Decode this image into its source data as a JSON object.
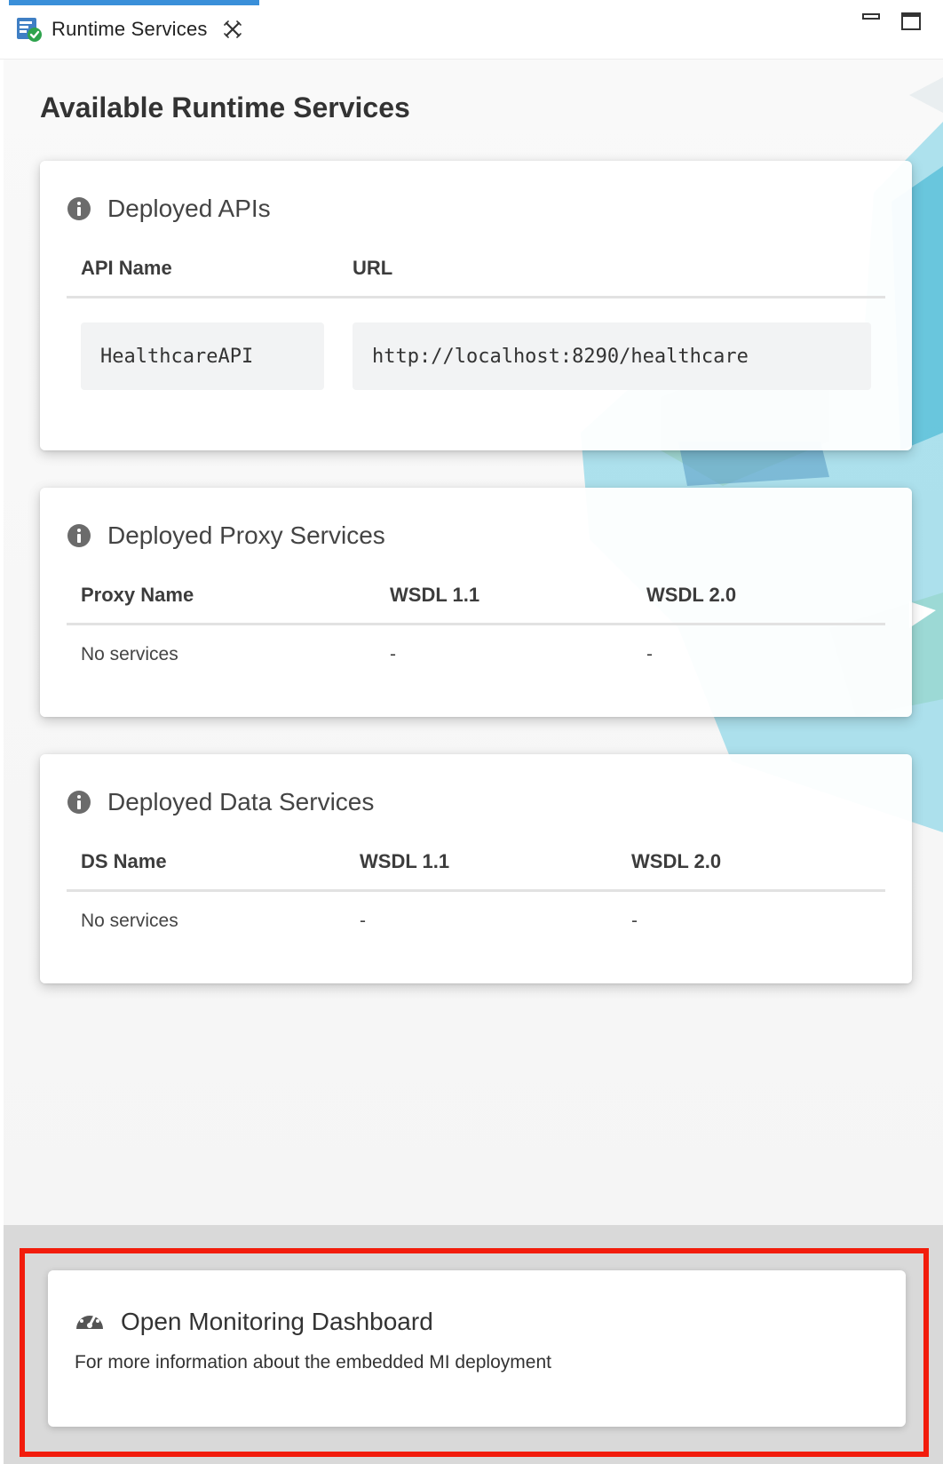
{
  "tab": {
    "title": "Runtime Services",
    "icon": "runtime-services-icon",
    "close_icon": "close-icon"
  },
  "window_controls": {
    "minimize_icon": "minimize-icon",
    "maximize_icon": "maximize-icon"
  },
  "page": {
    "title": "Available Runtime Services"
  },
  "apis": {
    "title": "Deployed APIs",
    "icon": "info-icon",
    "columns": [
      "API Name",
      "URL"
    ],
    "rows": [
      {
        "name": "HealthcareAPI",
        "url": "http://localhost:8290/healthcare"
      }
    ]
  },
  "proxy_services": {
    "title": "Deployed Proxy Services",
    "icon": "info-icon",
    "columns": [
      "Proxy Name",
      "WSDL 1.1",
      "WSDL 2.0"
    ],
    "rows": [
      {
        "name": "No services",
        "wsdl11": "-",
        "wsdl20": "-"
      }
    ]
  },
  "data_services": {
    "title": "Deployed Data Services",
    "icon": "info-icon",
    "columns": [
      "DS Name",
      "WSDL 1.1",
      "WSDL 2.0"
    ],
    "rows": [
      {
        "name": "No services",
        "wsdl11": "-",
        "wsdl20": "-"
      }
    ]
  },
  "dashboard": {
    "title": "Open Monitoring Dashboard",
    "description": "For more information about the embedded MI deployment",
    "icon": "speedometer-icon"
  },
  "colors": {
    "tab_accent": "#3a8fd9",
    "highlight_border": "#f21c0c",
    "panel_bg": "#d9d9d9",
    "decor_teal": "#5fc6e0"
  }
}
